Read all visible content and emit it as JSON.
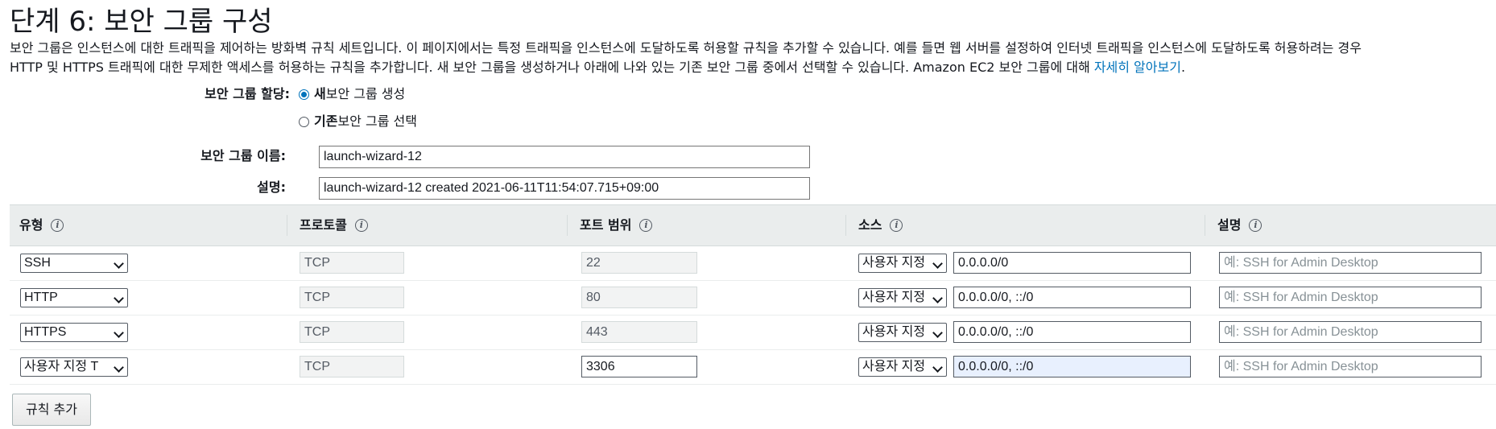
{
  "page": {
    "title": "단계 6: 보안 그룹 구성",
    "description_line1": "보안 그룹은 인스턴스에 대한 트래픽을 제어하는 방화벽 규칙 세트입니다. 이 페이지에서는 특정 트래픽을 인스턴스에 도달하도록 허용할 규칙을 추가할 수 있습니다. 예를 들면 웹 서버를 설정하여 인터넷 트래픽을 인스턴스에 도달하도록 허용하려는 경우",
    "description_line2": "HTTP 및 HTTPS 트래픽에 대한 무제한 액세스를 허용하는 규칙을 추가합니다. 새 보안 그룹을 생성하거나 아래에 나와 있는 기존 보안 그룹 중에서 선택할 수 있습니다. Amazon EC2 보안 그룹에 대해",
    "learn_more_link": "자세히 알아보기",
    "period": "."
  },
  "assignment": {
    "label": "보안 그룹 할당:",
    "option_new_bold": "새",
    "option_new_rest": " 보안 그룹 생성",
    "option_existing_bold": "기존",
    "option_existing_rest": " 보안 그룹 선택",
    "selected": "new"
  },
  "group_name": {
    "label": "보안 그룹 이름:",
    "value": "launch-wizard-12"
  },
  "group_description": {
    "label": "설명:",
    "value": "launch-wizard-12 created 2021-06-11T11:54:07.715+09:00"
  },
  "table": {
    "headers": {
      "type": "유형",
      "protocol": "프로토콜",
      "port_range": "포트 범위",
      "source": "소스",
      "description": "설명"
    },
    "rows": [
      {
        "type": "SSH",
        "protocol": "TCP",
        "port": "22",
        "source_select": "사용자 지정",
        "source": "0.0.0.0/0",
        "description_placeholder": "예: SSH for Admin Desktop"
      },
      {
        "type": "HTTP",
        "protocol": "TCP",
        "port": "80",
        "source_select": "사용자 지정",
        "source": "0.0.0.0/0, ::/0",
        "description_placeholder": "예: SSH for Admin Desktop"
      },
      {
        "type": "HTTPS",
        "protocol": "TCP",
        "port": "443",
        "source_select": "사용자 지정",
        "source": "0.0.0.0/0, ::/0",
        "description_placeholder": "예: SSH for Admin Desktop"
      },
      {
        "type": "사용자 지정 T",
        "protocol": "TCP",
        "port": "3306",
        "source_select": "사용자 지정",
        "source": "0.0.0.0/0, ::/0",
        "description_placeholder": "예: SSH for Admin Desktop"
      }
    ]
  },
  "add_rule_button": "규칙 추가",
  "colors": {
    "link": "#0073bb",
    "header_bg": "#eaeded",
    "focused_input_bg": "#e8f0fe"
  }
}
